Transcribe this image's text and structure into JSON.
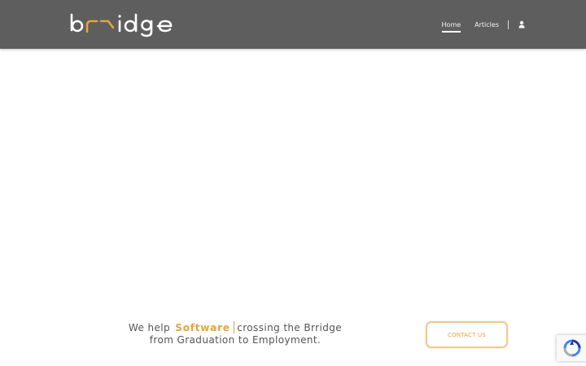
{
  "header": {
    "logo_text": "brridge",
    "nav": {
      "home_label": "Home",
      "articles_label": "Articles",
      "user_icon": "user-icon"
    }
  },
  "hero": {
    "tagline_prefix": "We help",
    "tagline_highlight": "Software",
    "tagline_suffix": "crossing the Brridge",
    "tagline_line2": "from Graduation to Employment.",
    "contact_button_label": "CONTACT US"
  },
  "recaptcha": {
    "icon": "recaptcha-icon"
  },
  "colors": {
    "header_bg": "#5e5e5e",
    "accent": "#e8a23c",
    "accent_light": "#f0c98e",
    "text": "#555555"
  }
}
